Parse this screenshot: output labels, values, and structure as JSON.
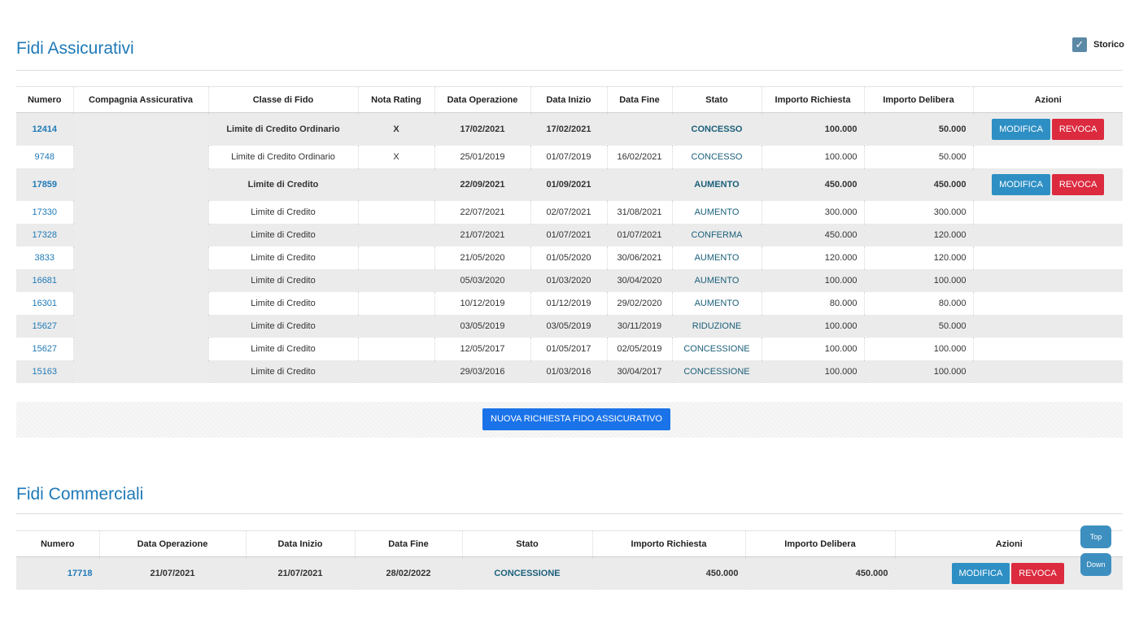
{
  "assicurativi": {
    "title": "Fidi Assicurativi",
    "storico_label": "Storico",
    "storico_checked_glyph": "✓",
    "columns": [
      "Numero",
      "Compagnia Assicurativa",
      "Classe di Fido",
      "Nota Rating",
      "Data Operazione",
      "Data Inizio",
      "Data Fine",
      "Stato",
      "Importo Richiesta",
      "Importo Delibera",
      "Azioni"
    ],
    "rows": [
      {
        "numero": "12414",
        "compagnia": "",
        "classe": "Limite di Credito Ordinario",
        "nota": "X",
        "data_op": "17/02/2021",
        "data_inizio": "17/02/2021",
        "data_fine": "",
        "stato": "CONCESSO",
        "importo_richiesta": "100.000",
        "importo_delibera": "50.000",
        "modifica": "MODIFICA",
        "revoca": "REVOCA"
      },
      {
        "numero": "9748",
        "compagnia": "",
        "classe": "Limite di Credito Ordinario",
        "nota": "X",
        "data_op": "25/01/2019",
        "data_inizio": "01/07/2019",
        "data_fine": "16/02/2021",
        "stato": "CONCESSO",
        "importo_richiesta": "100.000",
        "importo_delibera": "50.000"
      },
      {
        "numero": "17859",
        "compagnia": "",
        "classe": "Limite di Credito",
        "nota": "",
        "data_op": "22/09/2021",
        "data_inizio": "01/09/2021",
        "data_fine": "",
        "stato": "AUMENTO",
        "importo_richiesta": "450.000",
        "importo_delibera": "450.000",
        "modifica": "MODIFICA",
        "revoca": "REVOCA"
      },
      {
        "numero": "17330",
        "compagnia": "",
        "classe": "Limite di Credito",
        "nota": "",
        "data_op": "22/07/2021",
        "data_inizio": "02/07/2021",
        "data_fine": "31/08/2021",
        "stato": "AUMENTO",
        "importo_richiesta": "300.000",
        "importo_delibera": "300.000"
      },
      {
        "numero": "17328",
        "compagnia": "",
        "classe": "Limite di Credito",
        "nota": "",
        "data_op": "21/07/2021",
        "data_inizio": "01/07/2021",
        "data_fine": "01/07/2021",
        "stato": "CONFERMA",
        "importo_richiesta": "450.000",
        "importo_delibera": "120.000"
      },
      {
        "numero": "3833",
        "compagnia": "",
        "classe": "Limite di Credito",
        "nota": "",
        "data_op": "21/05/2020",
        "data_inizio": "01/05/2020",
        "data_fine": "30/06/2021",
        "stato": "AUMENTO",
        "importo_richiesta": "120.000",
        "importo_delibera": "120.000"
      },
      {
        "numero": "16681",
        "compagnia": "",
        "classe": "Limite di Credito",
        "nota": "",
        "data_op": "05/03/2020",
        "data_inizio": "01/03/2020",
        "data_fine": "30/04/2020",
        "stato": "AUMENTO",
        "importo_richiesta": "100.000",
        "importo_delibera": "100.000"
      },
      {
        "numero": "16301",
        "compagnia": "",
        "classe": "Limite di Credito",
        "nota": "",
        "data_op": "10/12/2019",
        "data_inizio": "01/12/2019",
        "data_fine": "29/02/2020",
        "stato": "AUMENTO",
        "importo_richiesta": "80.000",
        "importo_delibera": "80.000"
      },
      {
        "numero": "15627",
        "compagnia": "",
        "classe": "Limite di Credito",
        "nota": "",
        "data_op": "03/05/2019",
        "data_inizio": "03/05/2019",
        "data_fine": "30/11/2019",
        "stato": "RIDUZIONE",
        "importo_richiesta": "100.000",
        "importo_delibera": "50.000"
      },
      {
        "numero": "15627",
        "compagnia": "",
        "classe": "Limite di Credito",
        "nota": "",
        "data_op": "12/05/2017",
        "data_inizio": "01/05/2017",
        "data_fine": "02/05/2019",
        "stato": "CONCESSIONE",
        "importo_richiesta": "100.000",
        "importo_delibera": "100.000"
      },
      {
        "numero": "15163",
        "compagnia": "",
        "classe": "Limite di Credito",
        "nota": "",
        "data_op": "29/03/2016",
        "data_inizio": "01/03/2016",
        "data_fine": "30/04/2017",
        "stato": "CONCESSIONE",
        "importo_richiesta": "100.000",
        "importo_delibera": "100.000"
      }
    ],
    "new_request_label": "NUOVA RICHIESTA FIDO ASSICURATIVO"
  },
  "commerciali": {
    "title": "Fidi Commerciali",
    "columns": [
      "Numero",
      "Data Operazione",
      "Data Inizio",
      "Data Fine",
      "Stato",
      "Importo Richiesta",
      "Importo Delibera",
      "Azioni"
    ],
    "rows": [
      {
        "numero": "17718",
        "data_op": "21/07/2021",
        "data_inizio": "21/07/2021",
        "data_fine": "28/02/2022",
        "stato": "CONCESSIONE",
        "importo_richiesta": "450.000",
        "importo_delibera": "450.000",
        "modifica": "MODIFICA",
        "revoca": "REVOCA"
      }
    ]
  },
  "scroll": {
    "top_label": "Top",
    "down_label": "Down"
  },
  "colors": {
    "title": "#1f7ab8",
    "link": "#1f7ab8",
    "modifica": "#2e8fc4",
    "revoca": "#dc2a3f",
    "primary": "#1a73e8",
    "row_alt": "#ebebeb"
  }
}
